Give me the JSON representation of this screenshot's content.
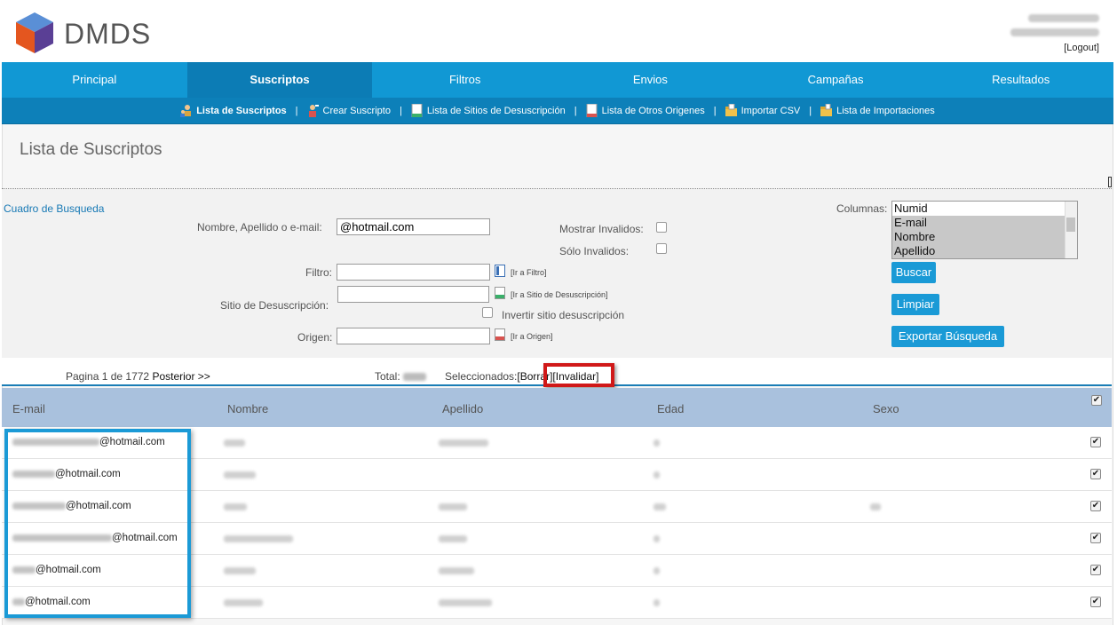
{
  "app": {
    "brand": "DMDS",
    "logout_label": "[Logout]"
  },
  "nav": {
    "items": [
      {
        "label": "Principal"
      },
      {
        "label": "Suscriptos"
      },
      {
        "label": "Filtros"
      },
      {
        "label": "Envios"
      },
      {
        "label": "Campañas"
      },
      {
        "label": "Resultados"
      }
    ],
    "active": "Suscriptos"
  },
  "subnav": {
    "items": [
      {
        "label": "Lista de Suscriptos",
        "icon": "users-icon"
      },
      {
        "label": "Crear Suscripto",
        "icon": "user-add-icon"
      },
      {
        "label": "Lista de Sitios de Desuscripción",
        "icon": "document-icon"
      },
      {
        "label": "Lista de Otros Origenes",
        "icon": "document-icon"
      },
      {
        "label": "Importar CSV",
        "icon": "folder-import-icon"
      },
      {
        "label": "Lista de Importaciones",
        "icon": "folder-list-icon"
      }
    ],
    "separator": "|"
  },
  "page": {
    "title": "Lista de Suscriptos"
  },
  "search": {
    "title": "Cuadro de Busqueda",
    "name_label": "Nombre, Apellido o e-mail:",
    "name_value": "@hotmail.com",
    "show_invalid_label": "Mostrar Invalidos:",
    "only_invalid_label": "Sólo Invalidos:",
    "filter_label": "Filtro:",
    "filter_link": "[Ir a Filtro]",
    "unsub_label": "Sitio de Desuscripción:",
    "unsub_link": "[Ir a Sitio de Desuscripción]",
    "invert_label": "Invertir sitio desuscripción",
    "origin_label": "Origen:",
    "origin_link": "[Ir a Origen]",
    "columns_label": "Columnas:",
    "columns_options": [
      "Numid",
      "E-mail",
      "Nombre",
      "Apellido"
    ],
    "buttons": {
      "search": "Buscar",
      "clear": "Limpiar",
      "export": "Exportar Búsqueda"
    }
  },
  "pager": {
    "text": "Pagina 1 de 1772",
    "next": "Posterior >>",
    "total_label": "Total:",
    "selected_label": "Seleccionados:",
    "delete_link": "[Borrar]",
    "invalidate_link": "[Invalidar]"
  },
  "table": {
    "columns": [
      "E-mail",
      "Nombre",
      "Apellido",
      "Edad",
      "Sexo"
    ],
    "rows": [
      {
        "email": "@hotmail.com",
        "checked": true
      },
      {
        "email": "@hotmail.com",
        "checked": true
      },
      {
        "email": "@hotmail.com",
        "checked": true
      },
      {
        "email": "@hotmail.com",
        "checked": true
      },
      {
        "email": "@hotmail.com",
        "checked": true
      },
      {
        "email": "@hotmail.com",
        "checked": true
      }
    ],
    "check_mark": "✔"
  },
  "colors": {
    "nav": "#1198d4",
    "nav_active": "#0c7cb5",
    "highlight_red": "#d01818",
    "highlight_blue": "#1b9ad6"
  }
}
